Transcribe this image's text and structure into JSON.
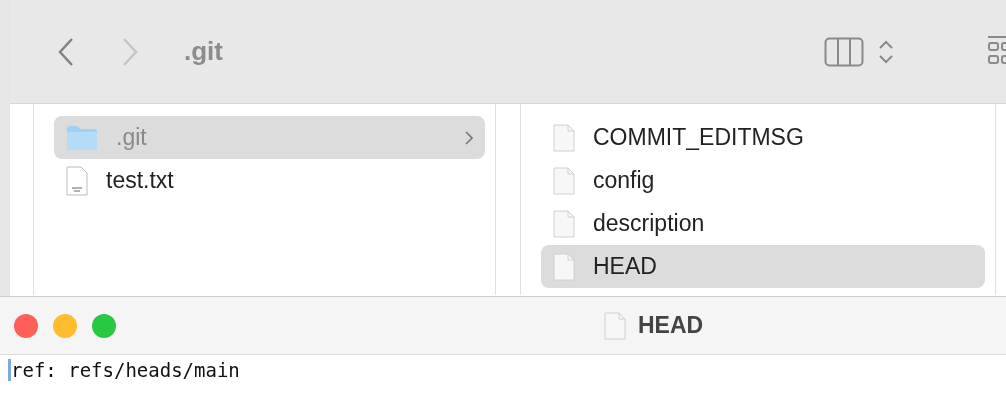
{
  "finder": {
    "title": ".git",
    "columns": [
      {
        "items": [
          {
            "name": ".git",
            "kind": "folder",
            "selected": true
          },
          {
            "name": "test.txt",
            "kind": "text",
            "selected": false
          }
        ]
      },
      {
        "items": [
          {
            "name": "COMMIT_EDITMSG",
            "kind": "document",
            "selected": false
          },
          {
            "name": "config",
            "kind": "document",
            "selected": false
          },
          {
            "name": "description",
            "kind": "document",
            "selected": false
          },
          {
            "name": "HEAD",
            "kind": "document",
            "selected": true
          }
        ]
      }
    ]
  },
  "editor": {
    "title": "HEAD",
    "content": "ref: refs/heads/main"
  }
}
